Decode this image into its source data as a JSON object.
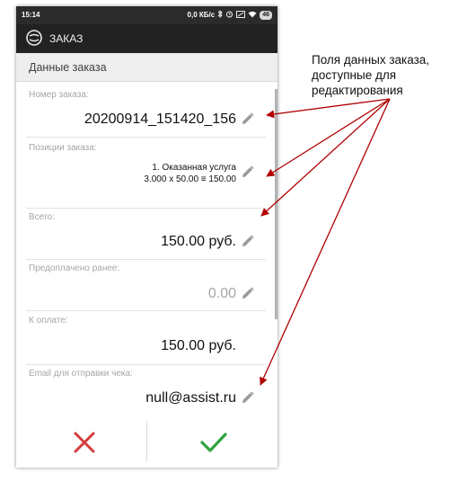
{
  "statusbar": {
    "time": "15:14",
    "speed": "0,0 КБ/с",
    "battery": "46"
  },
  "appbar": {
    "title": "ЗАКАЗ"
  },
  "section": {
    "title": "Данные заказа"
  },
  "fields": {
    "order_number": {
      "label": "Номер заказа:",
      "value": "20200914_151420_156"
    },
    "items": {
      "label": "Позиции заказа:",
      "line1": "1. Оказанная услуга",
      "line2": "3.000 x 50.00 ≡ 150.00"
    },
    "total": {
      "label": "Всего:",
      "value": "150.00 руб."
    },
    "prepaid": {
      "label": "Предоплачено ранее:",
      "value": "0.00"
    },
    "to_pay": {
      "label": "К оплате:",
      "value": "150.00 руб."
    },
    "email": {
      "label": "Email для отправки чека:",
      "value": "null@assist.ru"
    }
  },
  "annotation": {
    "line1": "Поля данных заказа,",
    "line2": "доступные для",
    "line3": "редактирования"
  },
  "colors": {
    "cancel": "#d33a3a",
    "confirm": "#2ea43a",
    "arrow": "#b00000"
  },
  "icons": [
    "wifi-icon",
    "bluetooth-icon",
    "alarm-icon",
    "signal-icon",
    "pencil-icon",
    "close-icon",
    "check-icon",
    "logo-icon"
  ]
}
